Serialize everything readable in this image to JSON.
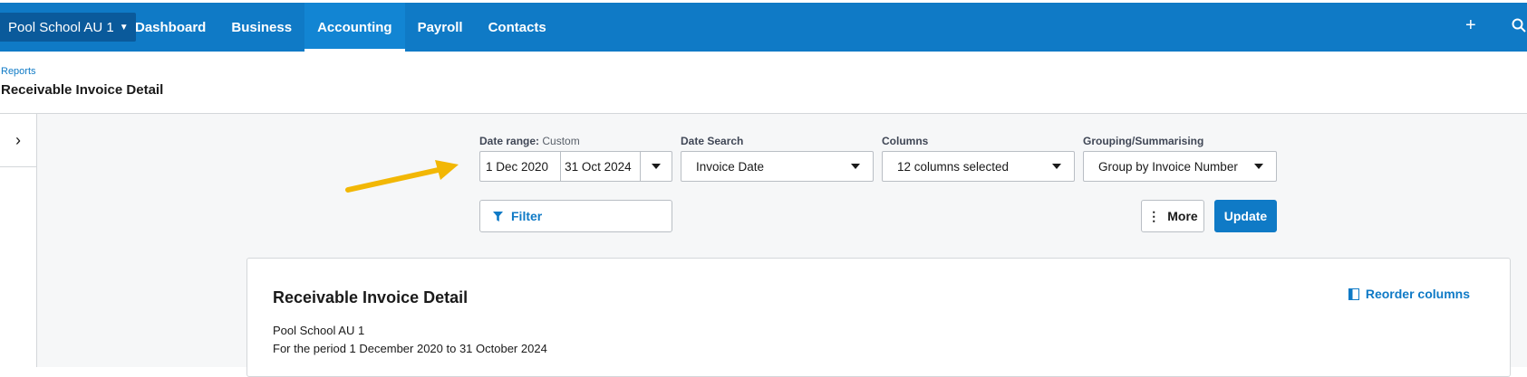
{
  "topbar": {
    "org_name": "Pool School AU 1",
    "nav": [
      "Dashboard",
      "Business",
      "Accounting",
      "Payroll",
      "Contacts"
    ],
    "active_nav": "Accounting",
    "icons": [
      "plus-icon",
      "search-icon"
    ]
  },
  "header": {
    "breadcrumb": "Reports",
    "title": "Receivable Invoice Detail"
  },
  "filters": {
    "date_range_label": "Date range:",
    "date_range_mode": "Custom",
    "date_from": "1 Dec 2020",
    "date_to": "31 Oct 2024",
    "date_search_label": "Date Search",
    "date_search_value": "Invoice Date",
    "columns_label": "Columns",
    "columns_value": "12 columns selected",
    "grouping_label": "Grouping/Summarising",
    "grouping_value": "Group by Invoice Number",
    "filter_button": "Filter",
    "more_button": "More",
    "update_button": "Update"
  },
  "report": {
    "title": "Receivable Invoice Detail",
    "org": "Pool School AU 1",
    "period": "For the period 1 December 2020 to 31 October 2024",
    "reorder_label": "Reorder columns"
  },
  "colors": {
    "brand_blue": "#0f7ac6",
    "annotation_arrow": "#f2b705"
  }
}
